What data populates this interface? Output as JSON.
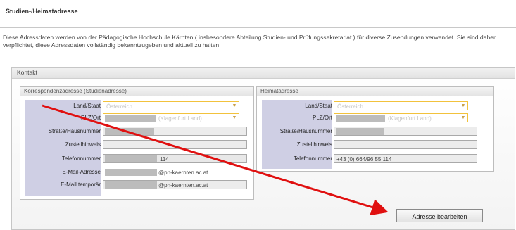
{
  "page_title": "Studien-/Heimatadresse",
  "intro_text": "Diese Adressdaten werden von der Pädagogische Hochschule Kärnten ( insbesondere Abteilung Studien- und Prüfungssekretariat ) für diverse Zusendungen verwendet. Sie sind daher verpflichtet, diese Adressdaten vollständig bekanntzugeben und aktuell zu halten.",
  "kontakt": {
    "title": "Kontakt",
    "studien": {
      "title": "Korrespondenzadresse (Studienadresse)",
      "fields": {
        "land_label": "Land/Staat",
        "land_value": "Österreich",
        "plz_label": "PLZ/Ort",
        "plz_value": "(Klagenfurt Land)",
        "strasse_label": "Straße/Hausnummer",
        "zustell_label": "Zustellhinweis",
        "tel_label": "Telefonnummer",
        "tel_value": "114",
        "email_label": "E-Mail-Adresse",
        "email_value": "@ph-kaernten.ac.at",
        "email_tmp_label": "E-Mail temporär",
        "email_tmp_value": "@ph-kaernten.ac.at"
      }
    },
    "heimat": {
      "title": "Heimatadresse",
      "fields": {
        "land_label": "Land/Staat",
        "land_value": "Österreich",
        "plz_label": "PLZ/Ort",
        "plz_value": "(Klagenfurt Land)",
        "strasse_label": "Straße/Hausnummer",
        "zustell_label": "Zustellhinweis",
        "tel_label": "Telefonnummer",
        "tel_value": "+43 (0) 664/96 55 114"
      }
    }
  },
  "edit_button": "Adresse bearbeiten",
  "colors": {
    "arrow": "#e01010",
    "select_border": "#f2c23c",
    "form_bg": "#cfcfe4"
  },
  "icons": {
    "dropdown": "chevron-down-icon"
  }
}
